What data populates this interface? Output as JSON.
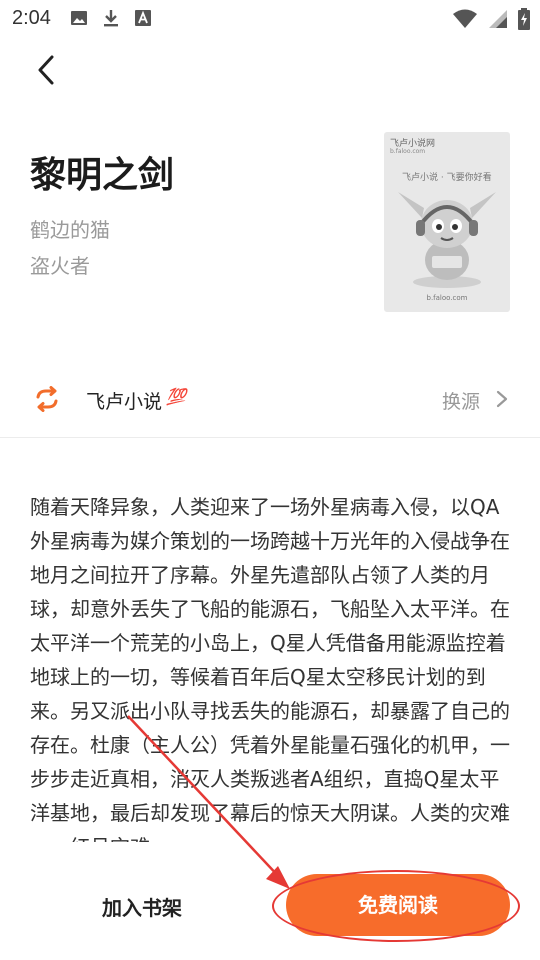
{
  "status_bar": {
    "time": "2:04"
  },
  "book": {
    "title": "黎明之剑",
    "author": "鹤边的猫",
    "category": "盗火者"
  },
  "cover": {
    "logo_text": "飞卢小说网",
    "logo_sub": "b.faloo.com",
    "slogan": "飞卢小说 · 飞要你好看",
    "url": "b.faloo.com"
  },
  "source": {
    "name": "飞卢小说",
    "badge": "💯",
    "switch_label": "换源"
  },
  "description": "随着天降异象，人类迎来了一场外星病毒入侵，以QA外星病毒为媒介策划的一场跨越十万光年的入侵战争在地月之间拉开了序幕。外星先遣部队占领了人类的月球，却意外丢失了飞船的能源石，飞船坠入太平洋。在太平洋一个荒芜的小岛上，Q星人凭借备用能源监控着地球上的一切，等候着百年后Q星太空移民计划的到来。另又派出小队寻找丢失的能源石，却暴露了自己的存在。杜康（主人公）凭着外星能量石强化的机甲，一步步走近真相，消灭人类叛逃者A组织，直捣Q星太平洋基地，最后却发现了幕后的惊天大阴谋。人类的灾难——红月灾难……",
  "actions": {
    "add_shelf": "加入书架",
    "read_free": "免费阅读"
  },
  "colors": {
    "accent": "#f76c2b",
    "annotation": "#e53935"
  }
}
